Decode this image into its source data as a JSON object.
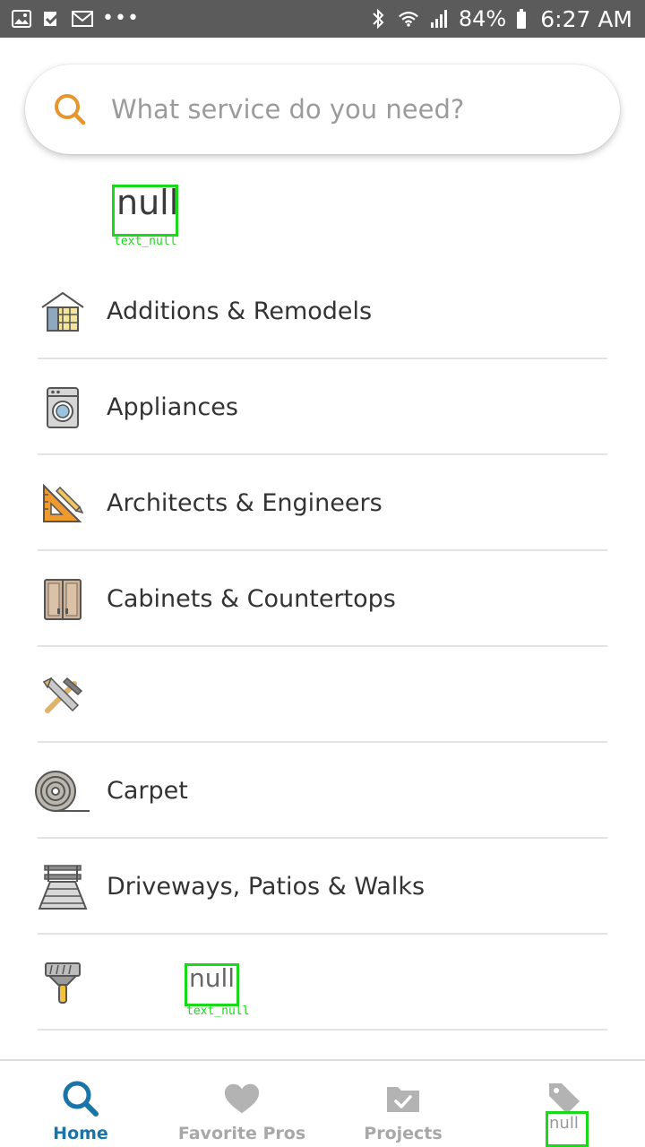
{
  "status_bar": {
    "battery": "84%",
    "time": "6:27 AM",
    "icons": [
      "gallery-icon",
      "checkbox-icon",
      "gmail-icon",
      "more-dots-icon",
      "bluetooth-icon",
      "wifi-icon",
      "signal-icon",
      "battery-icon"
    ]
  },
  "search": {
    "placeholder": "What service do you need?",
    "icon_color": "#e8952c"
  },
  "overlays": {
    "header_null": "null",
    "header_null_label": "text_null",
    "row_null": "null",
    "row_null_label": "text_null",
    "nav_null": "null"
  },
  "categories": [
    {
      "label": "Additions & Remodels",
      "icon": "house-icon"
    },
    {
      "label": "Appliances",
      "icon": "washing-machine-icon"
    },
    {
      "label": "Architects & Engineers",
      "icon": "set-square-pencil-icon"
    },
    {
      "label": "Cabinets & Countertops",
      "icon": "cabinet-icon"
    },
    {
      "label": "",
      "icon": "hammer-saw-icon"
    },
    {
      "label": "Carpet",
      "icon": "carpet-roll-icon"
    },
    {
      "label": "Driveways, Patios & Walks",
      "icon": "driveway-icon"
    },
    {
      "label": "",
      "icon": "paint-brush-icon"
    }
  ],
  "bottom_nav": {
    "items": [
      {
        "label": "Home",
        "icon": "search-icon",
        "active": true
      },
      {
        "label": "Favorite Pros",
        "icon": "heart-icon",
        "active": false
      },
      {
        "label": "Projects",
        "icon": "folder-check-icon",
        "active": false
      },
      {
        "label": "",
        "icon": "tag-icon",
        "active": false
      }
    ],
    "active_color": "#1a74a8",
    "inactive_color": "#a8a8a8"
  }
}
